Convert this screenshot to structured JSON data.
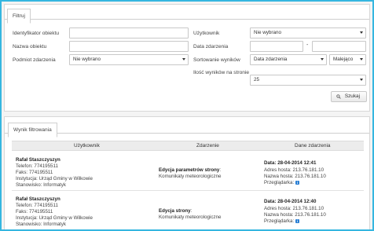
{
  "filter": {
    "tab_label": "Filtruj",
    "labels": {
      "object_id": "Identyfikator obiektu",
      "object_name": "Nazwa obiektu",
      "event_subject": "Podmiot zdarzenia",
      "user": "Użytkownik",
      "event_date": "Data zdarzenia",
      "sort_results": "Sortowanie wyników",
      "results_per_page": "Ilość wyników na stronie"
    },
    "values": {
      "object_id": "",
      "object_name": "",
      "event_subject": "Nie wybrano",
      "user": "Nie wybrano",
      "date_from": "",
      "date_to": "",
      "sort_field": "Data zdarzenia",
      "sort_order": "Malejąco",
      "results_per_page": "25"
    },
    "date_separator": "-",
    "search_button": "Szukaj"
  },
  "results": {
    "tab_label": "Wynik filtrowania",
    "columns": {
      "user": "Użytkownik",
      "event": "Zdarzenie",
      "event_data": "Dane zdarzenia"
    },
    "rows": [
      {
        "user_name": "Rafał Staszczyszyn",
        "phone": "Telefon: 774195511",
        "fax": "Faks: 774195511",
        "institution": "Instytucja: Urząd Gminy w Wilkowie",
        "position": "Stanowisko: Informatyk",
        "event_title": "Edycja parametrów strony",
        "event_suffix": ":",
        "event_subtitle": "Komunikaty meteorologiczne",
        "date": "Data: 28-04-2014 12:41",
        "host_address": "Adres hosta: 213.76.181.10",
        "host_name": "Nazwa hosta: 213.76.181.10",
        "browser": "Przeglądarka:"
      },
      {
        "user_name": "Rafał Staszczyszyn",
        "phone": "Telefon: 774195511",
        "fax": "Faks: 774195511",
        "institution": "Instytucja: Urząd Gminy w Wilkowie",
        "position": "Stanowisko: Informatyk",
        "event_title": "Edycja strony",
        "event_suffix": ":",
        "event_subtitle": "Komunikaty meteorologiczne",
        "date": "Data: 28-04-2014 12:40",
        "host_address": "Adres hosta: 213.76.181.10",
        "host_name": "Nazwa hosta: 213.76.181.10",
        "browser": "Przeglądarka:"
      }
    ]
  },
  "colors": {
    "frame_border": "#35b6e0",
    "info_icon": "#2a7fd4",
    "header_bg": "#ececec"
  }
}
